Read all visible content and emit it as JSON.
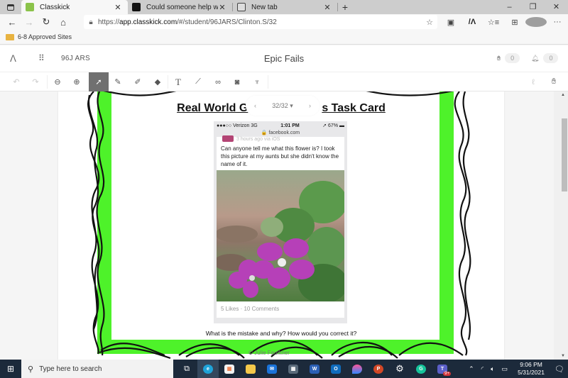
{
  "browser": {
    "tabs": [
      {
        "title": "Classkick",
        "active": true,
        "favicon_color": "#8bc34a"
      },
      {
        "title": "Could someone help with these",
        "active": false,
        "favicon_color": "#111111"
      },
      {
        "title": "New tab",
        "active": false,
        "favicon_color": "#555555"
      }
    ],
    "new_tab_label": "+",
    "url_prefix": "https://",
    "url_host": "app.classkick.com",
    "url_path": "/#/student/96JARS/Clinton.S/32",
    "bookmark_folder": "6-8 Approved Sites",
    "window_controls": {
      "minimize": "–",
      "restore": "❐",
      "close": "✕"
    }
  },
  "classkick": {
    "roster_code": "96J ARS",
    "assignment_title": "Epic Fails",
    "help_count": "0",
    "notification_count": "0",
    "pager": {
      "label": "32/32 ▾",
      "prev": "‹",
      "next": "›"
    }
  },
  "toolbar": {
    "tools": [
      {
        "name": "undo",
        "glyph": "↶"
      },
      {
        "name": "redo",
        "glyph": "↷"
      },
      {
        "name": "zoom-out",
        "glyph": "⊖"
      },
      {
        "name": "zoom-in",
        "glyph": "⊕"
      },
      {
        "name": "select",
        "glyph": "➚"
      },
      {
        "name": "pen",
        "glyph": "✎"
      },
      {
        "name": "highlighter",
        "glyph": "✐"
      },
      {
        "name": "eraser",
        "glyph": "◆"
      },
      {
        "name": "text",
        "glyph": "T"
      },
      {
        "name": "line",
        "glyph": "⟋"
      },
      {
        "name": "link",
        "glyph": "∞"
      },
      {
        "name": "camera",
        "glyph": "◙"
      },
      {
        "name": "microphone",
        "glyph": "♆"
      }
    ]
  },
  "card": {
    "title": "Real World Grammar Fails Task Card",
    "title_visible_left": "Real World G",
    "title_visible_right": "s Task Card",
    "phone_status": {
      "carrier": "●●●○○ Verizon  3G",
      "time": "1:01 PM",
      "battery": "➚ 67% ▬"
    },
    "phone_url": "🔒 facebook.com",
    "post_meta": "3 hours ago via iOS",
    "post_text": "Can anyone tell me what this flower is? I took this picture at my aunts but she didn't know the name of it.",
    "post_stats": "5 Likes · 10 Comments",
    "question": "What is the mistake and why? How would you correct it?",
    "copyright": "© Julie Faulkner"
  },
  "taskbar": {
    "search_placeholder": "Type here to search",
    "time": "9:06 PM",
    "date": "5/31/2021",
    "apps": [
      {
        "name": "task-view",
        "glyph": "⧉",
        "color": "#ffffff"
      },
      {
        "name": "edge",
        "glyph": "e",
        "color": "#1fa3d8"
      },
      {
        "name": "store",
        "glyph": "🛍",
        "color": "#ffffff"
      },
      {
        "name": "file-explorer",
        "glyph": "",
        "color": "#f4c84a"
      },
      {
        "name": "mail",
        "glyph": "✉",
        "color": "#1a73d9"
      },
      {
        "name": "calculator",
        "glyph": "▦",
        "color": "#5a6a7a"
      },
      {
        "name": "word",
        "glyph": "W",
        "color": "#2b5fb4"
      },
      {
        "name": "outlook",
        "glyph": "O",
        "color": "#0f6cbd"
      },
      {
        "name": "paint",
        "glyph": "💧",
        "color": "#e05aa0"
      },
      {
        "name": "powerpoint",
        "glyph": "P",
        "color": "#d24726"
      },
      {
        "name": "settings",
        "glyph": "⚙",
        "color": "#ffffff"
      },
      {
        "name": "grammarly",
        "glyph": "G",
        "color": "#15c39a"
      },
      {
        "name": "teams",
        "glyph": "T",
        "color": "#5b5fc7"
      }
    ],
    "teams_badge": "9+"
  }
}
